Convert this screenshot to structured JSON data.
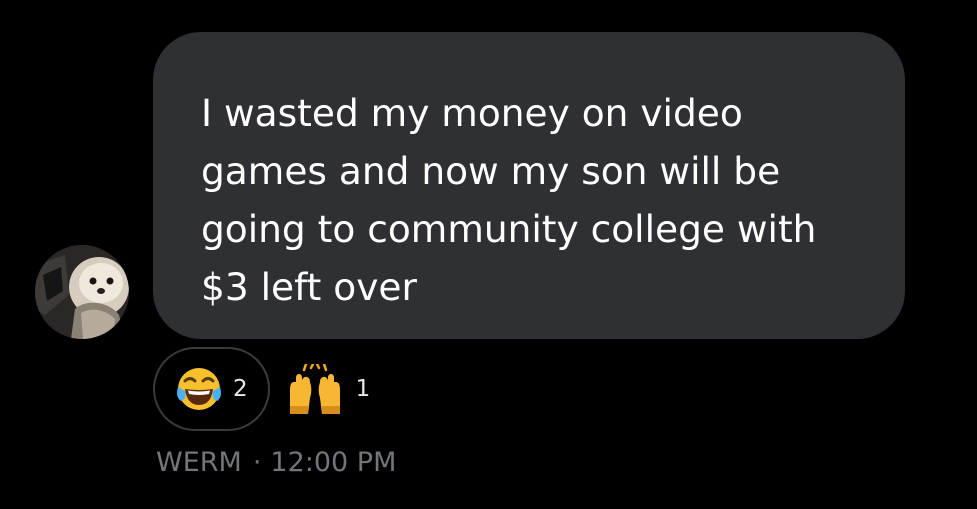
{
  "message": {
    "text": "I wasted my money on video\ngames and now my son will be\ngoing to community college with\n$3 left over"
  },
  "reactions": [
    {
      "icon": "face-with-tears-of-joy-icon",
      "count": "2",
      "selected": true
    },
    {
      "icon": "raising-hands-icon",
      "count": "1",
      "selected": false
    }
  ],
  "meta": {
    "sender": "WERM",
    "separator": "·",
    "time": "12:00 PM"
  },
  "colors": {
    "background": "#000000",
    "bubble": "#2f3033",
    "text": "#ffffff",
    "meta": "#71767b",
    "pill_border": "#3a3b3e"
  }
}
